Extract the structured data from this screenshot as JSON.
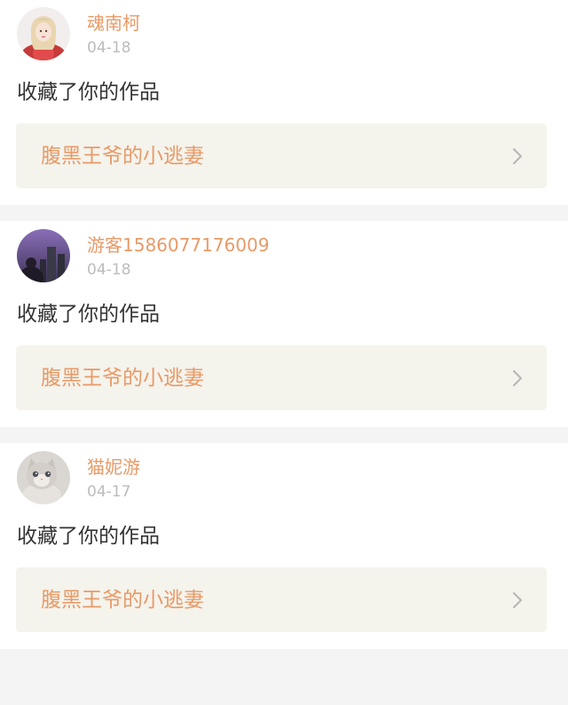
{
  "feed": {
    "items": [
      {
        "username": "魂南柯",
        "time": "04-18",
        "action": "收藏了你的作品",
        "work_title": "腹黑王爷的小逃妻",
        "avatar": "avatar-girl-red-icon"
      },
      {
        "username": "游客1586077176009",
        "time": "04-18",
        "action": "收藏了你的作品",
        "work_title": "腹黑王爷的小逃妻",
        "avatar": "avatar-purple-sky-icon"
      },
      {
        "username": "猫妮游",
        "time": "04-17",
        "action": "收藏了你的作品",
        "work_title": "腹黑王爷的小逃妻",
        "avatar": "avatar-cat-icon"
      }
    ]
  },
  "colors": {
    "accent": "#e89a67",
    "text": "#333333",
    "muted": "#bcbcbc",
    "link_bg": "#f4f3ec",
    "page_bg": "#f4f4f4"
  }
}
